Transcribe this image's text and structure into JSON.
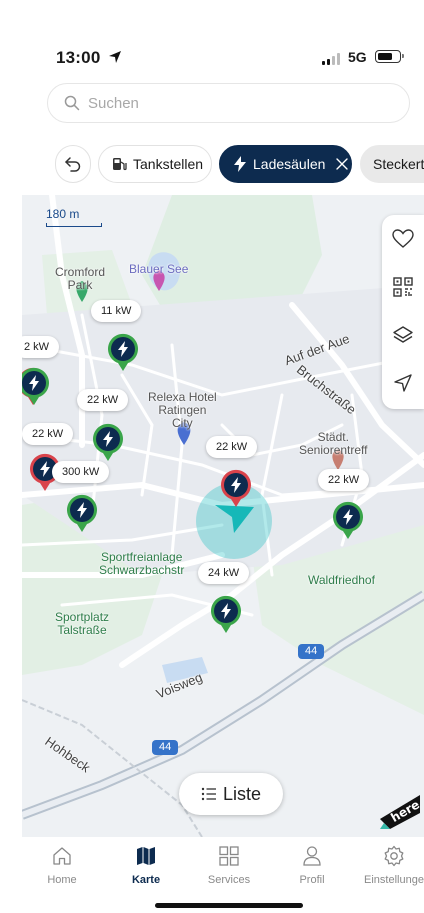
{
  "status": {
    "time": "13:00",
    "network": "5G"
  },
  "search": {
    "placeholder": "Suchen"
  },
  "chips": {
    "fuel": "Tankstellen",
    "charging": "Ladesäulen",
    "plug": "Steckerty"
  },
  "map": {
    "scale": "180 m",
    "places": {
      "cromford": "Cromford\nPark",
      "blauer_see": "Blauer See",
      "relexa": "Relexa Hotel\nRatingen\nCity",
      "auf_der_aue": "Auf der Aue",
      "bruchstrasse": "Bruchstraße",
      "seniorentreff": "Städt.\nSeniorentreff",
      "sportfreianlage": "Sportfreianlage\nSchwarzbachstr",
      "waldfriedhof": "Waldfriedhof",
      "sportplatz": "Sportplatz\nTalstraße",
      "voisweg": "Voisweg",
      "hohbeck": "Hohbeck",
      "road_44": "44"
    },
    "power_labels": [
      "11 kW",
      "2 kW",
      "22 kW",
      "22 kW",
      "300 kW",
      "22 kW",
      "22 kW",
      "24 kW"
    ]
  },
  "liste": "Liste",
  "tabs": [
    "Home",
    "Karte",
    "Services",
    "Profil",
    "Einstellunge"
  ],
  "colors": {
    "navy": "#0d2b4f",
    "pin_green": "#3aa54a",
    "pin_red": "#d9434b",
    "location": "#22c1c3"
  }
}
